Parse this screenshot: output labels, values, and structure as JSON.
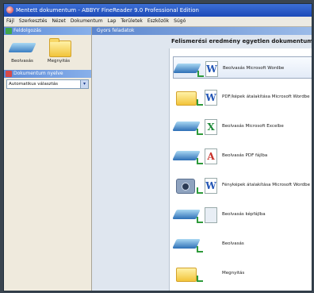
{
  "window": {
    "title": "Mentett dokumentum - ABBYY FineReader 9.0 Professional Edition"
  },
  "menu": {
    "items": [
      "Fájl",
      "Szerkesztés",
      "Nézet",
      "Dokumentum",
      "Lap",
      "Területek",
      "Eszközök",
      "Súgó"
    ]
  },
  "sidebar": {
    "header": "Feldolgozás",
    "tiles": [
      {
        "label": "Beolvasás",
        "icon": "scanner-icon"
      },
      {
        "label": "Megnyitás",
        "icon": "folder-icon"
      }
    ],
    "language_header": "Dokumentum nyelve",
    "language_value": "Automatikus választás"
  },
  "main": {
    "header": "Gyors feladatok",
    "task_title": "Felismerési eredmény egyetlen dokumentumba",
    "tasks": [
      {
        "label": "Beolvasás Microsoft Wordbe",
        "icon": "scan-to-word-icon",
        "doc_letter": "W",
        "doc_color": "#2356b5"
      },
      {
        "label": "PDF/képek átalakítása Microsoft Wordbe",
        "icon": "pdf-to-word-icon",
        "doc_letter": "W",
        "doc_color": "#2356b5"
      },
      {
        "label": "Beolvasás Microsoft Excelbe",
        "icon": "scan-to-excel-icon",
        "doc_letter": "X",
        "doc_color": "#1f8a3a"
      },
      {
        "label": "Beolvasás PDF fájlba",
        "icon": "scan-to-pdf-icon",
        "doc_letter": "A",
        "doc_color": "#c8312a"
      },
      {
        "label": "Fényképek átalakítása Microsoft Wordbe",
        "icon": "photo-to-word-icon",
        "doc_letter": "W",
        "doc_color": "#2356b5"
      },
      {
        "label": "Beolvasás képfájlba",
        "icon": "scan-to-image-icon",
        "doc_letter": "",
        "doc_color": "#888888"
      },
      {
        "label": "Beolvasás",
        "icon": "scan-icon",
        "doc_letter": "",
        "doc_color": "#888888"
      },
      {
        "label": "Megnyitás",
        "icon": "open-icon",
        "doc_letter": "",
        "doc_color": "#888888"
      }
    ]
  }
}
